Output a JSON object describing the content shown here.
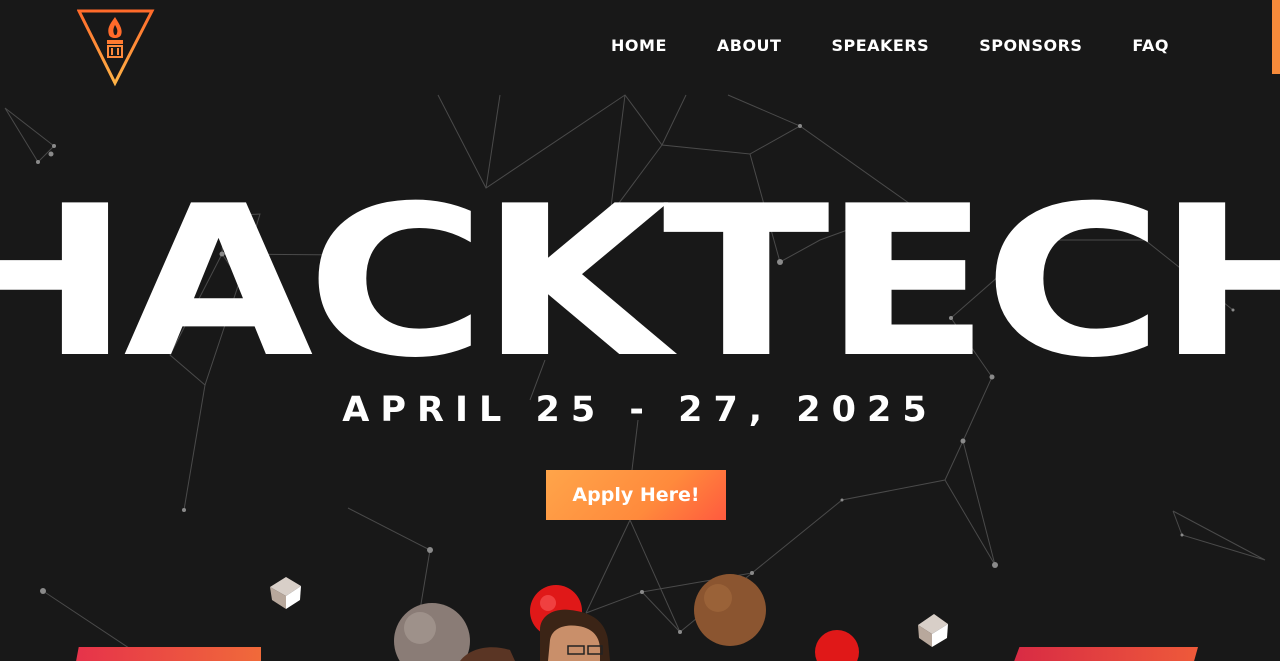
{
  "colors": {
    "background": "#181818",
    "accent_orange": "#ff8a3c",
    "accent_red": "#e6324a",
    "text": "#ffffff"
  },
  "nav": {
    "items": [
      {
        "label": "HOME"
      },
      {
        "label": "ABOUT"
      },
      {
        "label": "SPEAKERS"
      },
      {
        "label": "SPONSORS"
      },
      {
        "label": "FAQ"
      }
    ]
  },
  "logo": {
    "icon": "flame-torch-triangle-icon"
  },
  "hero": {
    "title": "HACKTECH",
    "date": "APRIL 25 - 27, 2025",
    "cta_label": "Apply Here!"
  }
}
